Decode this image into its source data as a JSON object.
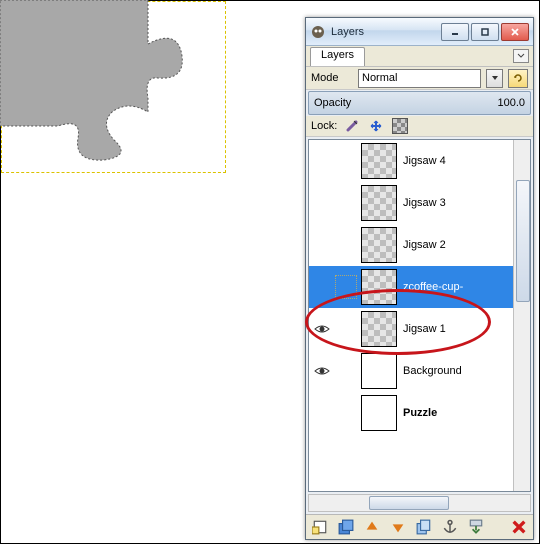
{
  "window": {
    "title": "Layers"
  },
  "tab": {
    "label": "Layers"
  },
  "mode": {
    "label": "Mode",
    "value": "Normal"
  },
  "opacity": {
    "label": "Opacity",
    "value": "100.0"
  },
  "lock": {
    "label": "Lock:"
  },
  "layers": [
    {
      "name": "Jigsaw 4",
      "thumb": "checker",
      "eye": false
    },
    {
      "name": "Jigsaw 3",
      "thumb": "checker",
      "eye": false
    },
    {
      "name": "Jigsaw 2",
      "thumb": "checker",
      "eye": false
    },
    {
      "name": "zcoffee-cup-",
      "thumb": "checker",
      "eye": false,
      "selected": true
    },
    {
      "name": "Jigsaw 1",
      "thumb": "checker",
      "eye": true
    },
    {
      "name": "Background",
      "thumb": "white",
      "eye": true
    },
    {
      "name": "Puzzle",
      "thumb": "white",
      "eye": false,
      "bold": true
    }
  ]
}
